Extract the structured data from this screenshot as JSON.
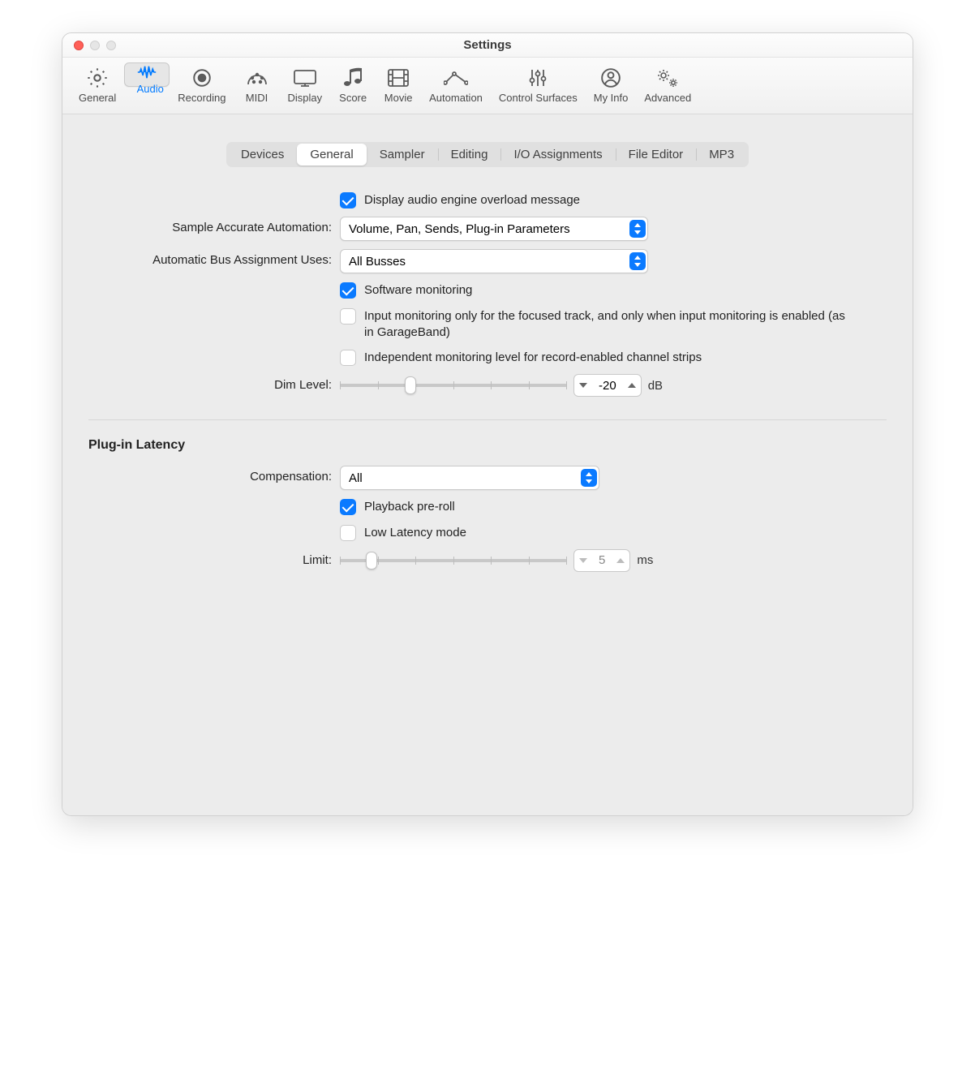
{
  "window": {
    "title": "Settings"
  },
  "toolbar": {
    "items": [
      {
        "label": "General"
      },
      {
        "label": "Audio"
      },
      {
        "label": "Recording"
      },
      {
        "label": "MIDI"
      },
      {
        "label": "Display"
      },
      {
        "label": "Score"
      },
      {
        "label": "Movie"
      },
      {
        "label": "Automation"
      },
      {
        "label": "Control Surfaces"
      },
      {
        "label": "My Info"
      },
      {
        "label": "Advanced"
      }
    ],
    "selected": "Audio"
  },
  "tabs": {
    "items": [
      "Devices",
      "General",
      "Sampler",
      "Editing",
      "I/O Assignments",
      "File Editor",
      "MP3"
    ],
    "selected": "General"
  },
  "section1": {
    "overload_chk": true,
    "overload_label": "Display audio engine overload message",
    "sample_accurate_label": "Sample Accurate Automation:",
    "sample_accurate_value": "Volume, Pan, Sends, Plug-in Parameters",
    "bus_label": "Automatic Bus Assignment Uses:",
    "bus_value": "All Busses",
    "sw_mon_chk": true,
    "sw_mon_label": "Software monitoring",
    "focused_chk": false,
    "focused_label": "Input monitoring only for the focused track, and only when input monitoring is enabled (as in GarageBand)",
    "indep_chk": false,
    "indep_label": "Independent monitoring level for record-enabled channel strips",
    "dim_label": "Dim Level:",
    "dim_value": "-20",
    "dim_unit": "dB",
    "dim_slider_pct": 31
  },
  "section2": {
    "heading": "Plug-in Latency",
    "comp_label": "Compensation:",
    "comp_value": "All",
    "preroll_chk": true,
    "preroll_label": "Playback pre-roll",
    "lowlat_chk": false,
    "lowlat_label": "Low Latency mode",
    "limit_label": "Limit:",
    "limit_value": "5",
    "limit_unit": "ms",
    "limit_slider_pct": 14
  }
}
